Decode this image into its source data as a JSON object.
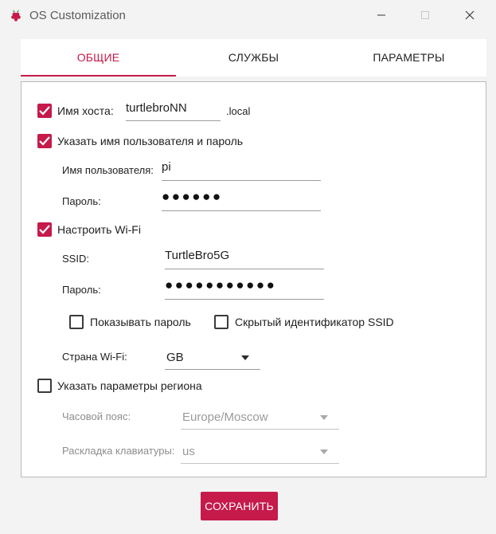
{
  "window": {
    "title": "OS Customization",
    "accent": "#c51a4a"
  },
  "tabs": [
    {
      "label": "ОБЩИЕ",
      "active": true
    },
    {
      "label": "СЛУЖБЫ",
      "active": false
    },
    {
      "label": "ПАРАМЕТРЫ",
      "active": false
    }
  ],
  "general": {
    "hostname": {
      "checked": true,
      "label": "Имя хоста:",
      "value": "turtlebroNN",
      "suffix": ".local"
    },
    "user": {
      "checked": true,
      "label": "Указать имя пользователя и пароль",
      "username_label": "Имя пользователя:",
      "username_value": "pi",
      "password_label": "Пароль:",
      "password_value": "●●●●●●"
    },
    "wifi": {
      "checked": true,
      "label": "Настроить Wi-Fi",
      "ssid_label": "SSID:",
      "ssid_value": "TurtleBro5G",
      "password_label": "Пароль:",
      "password_value": "●●●●●●●●●●●",
      "show_password": {
        "checked": false,
        "label": "Показывать пароль"
      },
      "hidden_ssid": {
        "checked": false,
        "label": "Скрытый идентификатор SSID"
      },
      "country_label": "Страна Wi-Fi:",
      "country_value": "GB"
    },
    "locale": {
      "checked": false,
      "label": "Указать параметры региона",
      "timezone_label": "Часовой пояс:",
      "timezone_value": "Europe/Moscow",
      "keyboard_label": "Раскладка клавиатуры:",
      "keyboard_value": "us"
    }
  },
  "save_button": "СОХРАНИТЬ"
}
